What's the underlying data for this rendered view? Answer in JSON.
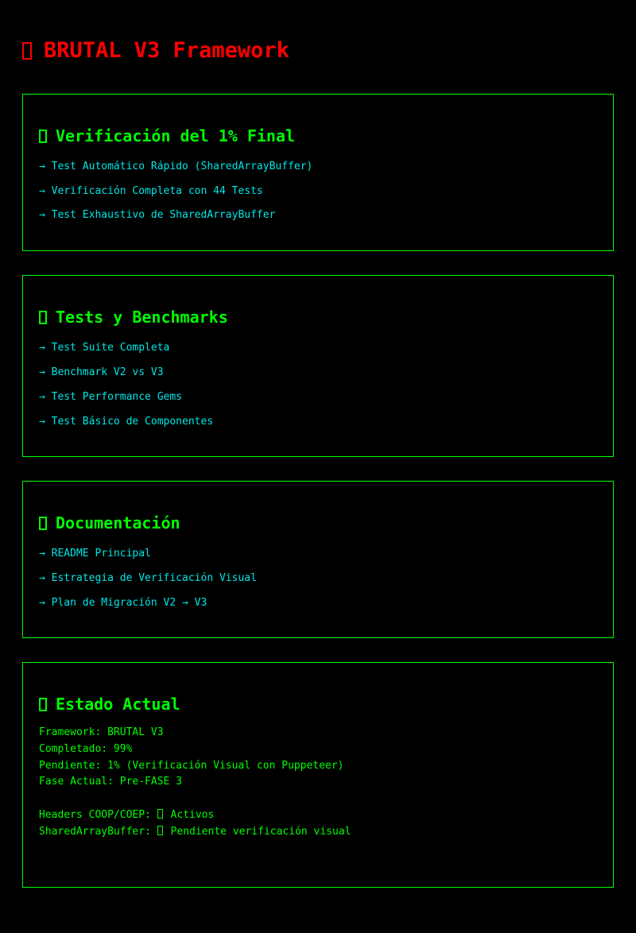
{
  "page": {
    "title": "BRUTAL V3 Framework",
    "icon": "box-glyph-icon"
  },
  "colors": {
    "background": "#000000",
    "title": "#ff0000",
    "accent": "#00ff00",
    "link": "#00e6e6"
  },
  "sections": [
    {
      "title": "Verificación del 1% Final",
      "links": [
        "→ Test Automático Rápido (SharedArrayBuffer)",
        "→ Verificación Completa con 44 Tests",
        "→ Test Exhaustivo de SharedArrayBuffer"
      ]
    },
    {
      "title": "Tests y Benchmarks",
      "links": [
        "→ Test Suite Completa",
        "→ Benchmark V2 vs V3",
        "→ Test Performance Gems",
        "→ Test Básico de Componentes"
      ]
    },
    {
      "title": "Documentación",
      "links": [
        "→ README Principal",
        "→ Estrategia de Verificación Visual",
        "→ Plan de Migración V2 → V3"
      ]
    }
  ],
  "status": {
    "title": "Estado Actual",
    "lines": [
      "Framework: BRUTAL V3",
      "Completado: 99%",
      "Pendiente: 1% (Verificación Visual con Puppeteer)",
      "Fase Actual: Pre-FASE 3"
    ],
    "headers_label": "Headers COOP/COEP: ",
    "headers_value": "Activos",
    "sab_label": "SharedArrayBuffer: ",
    "sab_value": "Pendiente verificación visual"
  }
}
